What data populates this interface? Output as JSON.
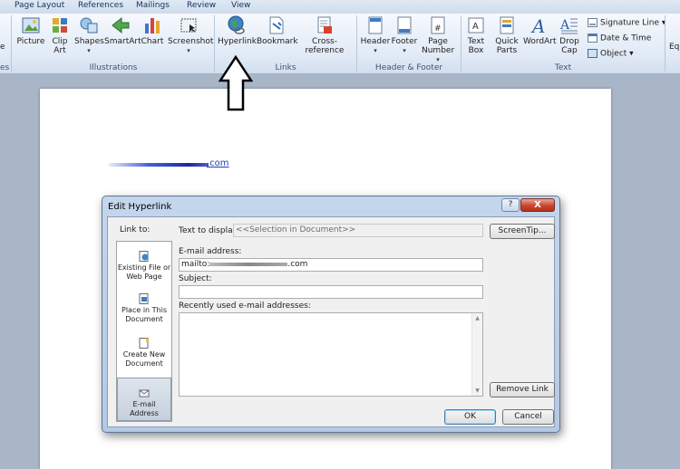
{
  "tabs": [
    "Page Layout",
    "References",
    "Mailings",
    "Review",
    "View"
  ],
  "ribbon": {
    "left_partial": {
      "e_label": "e",
      "es_label": "es"
    },
    "illustrations": {
      "buttons": [
        "Picture",
        "Clip Art",
        "Shapes",
        "SmartArt",
        "Chart",
        "Screenshot"
      ],
      "group_label": "Illustrations"
    },
    "links": {
      "buttons": [
        "Hyperlink",
        "Bookmark",
        "Cross-reference"
      ],
      "group_label": "Links"
    },
    "header_footer": {
      "buttons": [
        "Header",
        "Footer",
        "Page Number"
      ],
      "group_label": "Header & Footer"
    },
    "text": {
      "buttons": [
        "Text Box",
        "Quick Parts",
        "WordArt",
        "Drop Cap"
      ],
      "small_buttons": [
        "Signature Line",
        "Date & Time",
        "Object"
      ],
      "group_label": "Text"
    },
    "right_partial": "Eq"
  },
  "document": {
    "link_suffix": ".com"
  },
  "dialog": {
    "title": "Edit Hyperlink",
    "help": "?",
    "close": "X",
    "link_to_label": "Link to:",
    "link_to_items": [
      "Existing File or Web Page",
      "Place in This Document",
      "Create New Document",
      "E-mail Address"
    ],
    "text_to_display_label": "Text to display:",
    "text_to_display_value": "<<Selection in Document>>",
    "screentip_button": "ScreenTip...",
    "email_label": "E-mail address:",
    "email_prefix": "mailto:",
    "email_suffix": ".com",
    "subject_label": "Subject:",
    "subject_value": "",
    "recent_label": "Recently used e-mail addresses:",
    "remove_link_button": "Remove Link",
    "ok_button": "OK",
    "cancel_button": "Cancel"
  }
}
